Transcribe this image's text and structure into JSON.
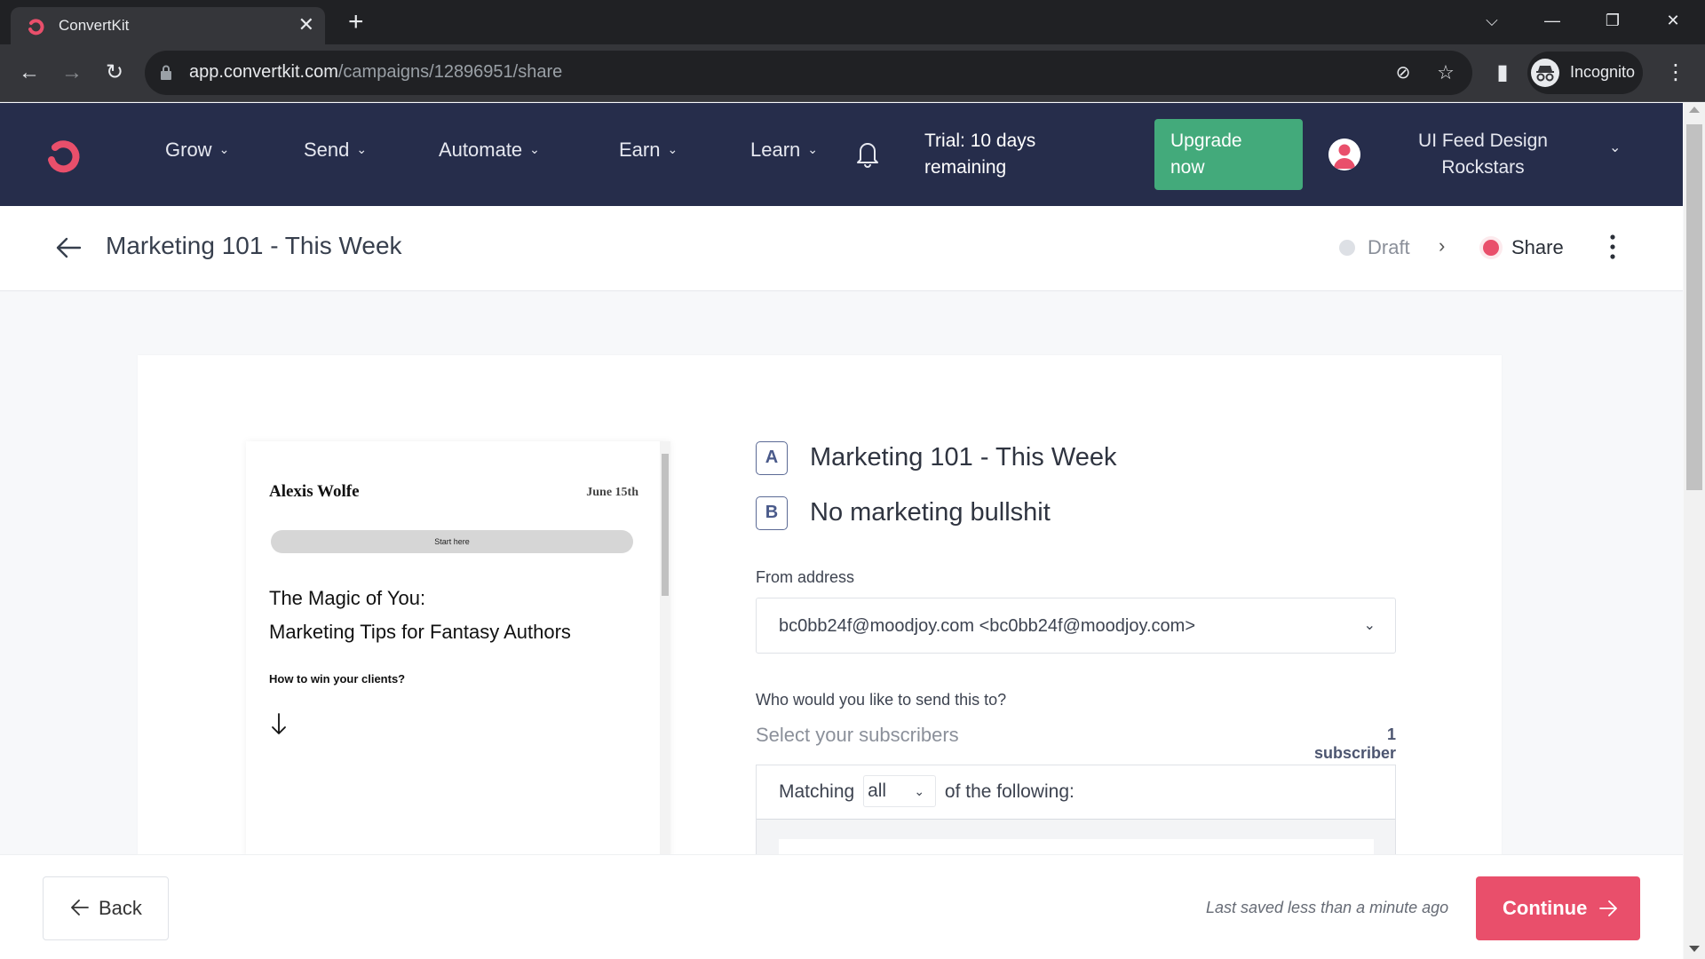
{
  "browser": {
    "tab_title": "ConvertKit",
    "url_host": "app.convertkit.com",
    "url_path": "/campaigns/12896951/share",
    "profile_label": "Incognito"
  },
  "nav": {
    "items": [
      {
        "label": "Grow"
      },
      {
        "label": "Send"
      },
      {
        "label": "Automate"
      },
      {
        "label": "Earn"
      },
      {
        "label": "Learn"
      }
    ],
    "trial_line1": "Trial: 10 days",
    "trial_line2": "remaining",
    "upgrade_line1": "Upgrade",
    "upgrade_line2": "now",
    "account_line1": "UI Feed Design",
    "account_line2": "Rockstars",
    "brand_color": "#e94f6b",
    "bg_color": "#262d4b",
    "upgrade_color": "#43aa7b"
  },
  "subheader": {
    "title": "Marketing 101 - This Week",
    "steps": [
      {
        "label": "Draft",
        "state": "completed",
        "dot_color": "#dde0e5"
      },
      {
        "label": "Share",
        "state": "current",
        "dot_color": "#e94f6b"
      }
    ]
  },
  "preview": {
    "author": "Alexis Wolfe",
    "date": "June 15th",
    "button_label": "Start here",
    "heading_line1": "The Magic of You:",
    "heading_line2": "Marketing Tips for Fantasy Authors",
    "subheading": "How to win your clients?"
  },
  "form": {
    "subjects": [
      {
        "badge": "A",
        "text": "Marketing 101 - This Week"
      },
      {
        "badge": "B",
        "text": "No marketing bullshit"
      }
    ],
    "from_label": "From address",
    "from_value": "bc0bb24f@moodjoy.com <bc0bb24f@moodjoy.com>",
    "recipients_label": "Who would you like to send this to?",
    "select_subscribers": "Select your subscribers",
    "subscriber_count": "1 subscriber",
    "matching_prefix": "Matching",
    "matching_value": "all",
    "matching_suffix": "of the following:"
  },
  "footer": {
    "back_label": "Back",
    "last_saved": "Last saved less than a minute ago",
    "continue_label": "Continue"
  }
}
